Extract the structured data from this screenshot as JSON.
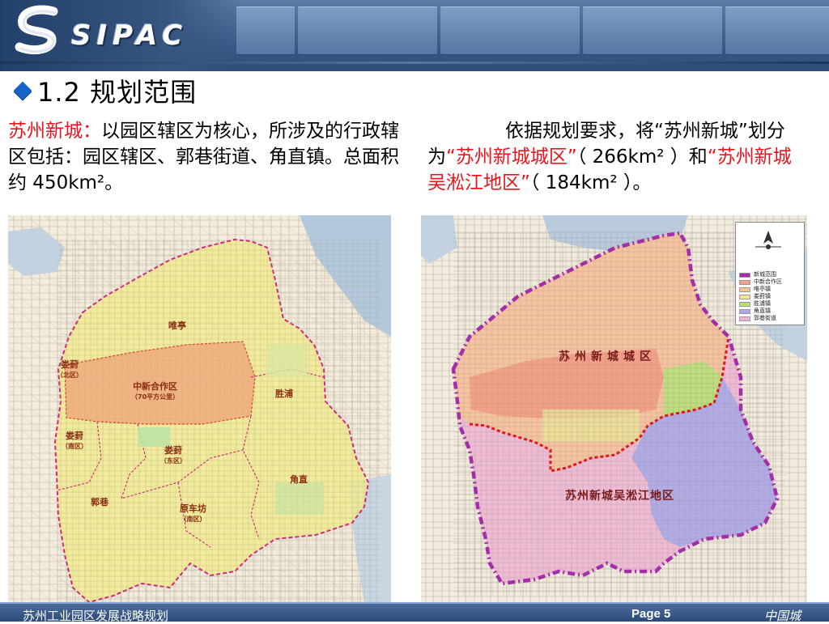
{
  "header": {
    "logo_text": "SIPAC",
    "colors": {
      "band": "#3e5e8c",
      "panel": "#6c8bb8"
    }
  },
  "title": {
    "text": "1.2 规划范围",
    "bullet_color": "#1565c8"
  },
  "left_text": {
    "highlight": "苏州新城：",
    "body": "以园区辖区为核心，所涉及的行政辖区包括：园区辖区、郭巷街道、角直镇。总面积约 450km²。"
  },
  "right_text": {
    "part1": "依据规划要求，将“苏州新城”划分为",
    "highlight1": "“苏州新城城区”",
    "part2": "（ 266km² ）和",
    "highlight2": "“苏州新城吴淞江地区”",
    "part3": "（ 184km² ）。"
  },
  "map_left": {
    "labels": [
      {
        "id": "weiting",
        "text": "唯亭"
      },
      {
        "id": "louyao-north",
        "text": "娄葑",
        "sub": "（北区）"
      },
      {
        "id": "zhongxin",
        "text": "中新合作区",
        "sub": "（70平方公里）"
      },
      {
        "id": "shengpu",
        "text": "胜浦"
      },
      {
        "id": "louyao-south",
        "text": "娄葑",
        "sub": "（南区）"
      },
      {
        "id": "louyao-east",
        "text": "娄葑",
        "sub": "（东区）"
      },
      {
        "id": "guoxiang",
        "text": "郭巷"
      },
      {
        "id": "yuanchefang",
        "text": "原车坊",
        "sub": "（南区）"
      },
      {
        "id": "luzhi",
        "text": "角直"
      }
    ]
  },
  "map_right": {
    "region_urban": "苏州新城城区",
    "region_wusong": "苏州新城吴淞江地区",
    "legend": [
      {
        "label": "新城范围",
        "color": "#a42ea8"
      },
      {
        "label": "中新合作区",
        "color": "#f1a38f"
      },
      {
        "label": "唯亭镇",
        "color": "#f5c58c"
      },
      {
        "label": "娄葑镇",
        "color": "#f6e48a"
      },
      {
        "label": "胜浦镇",
        "color": "#b7e07a"
      },
      {
        "label": "角直镇",
        "color": "#a9a8e8"
      },
      {
        "label": "郭巷街道",
        "color": "#efb2d7"
      }
    ]
  },
  "footer": {
    "left": "苏州工业园区发展战略规划",
    "page": "Page 5",
    "right": "中国城"
  }
}
